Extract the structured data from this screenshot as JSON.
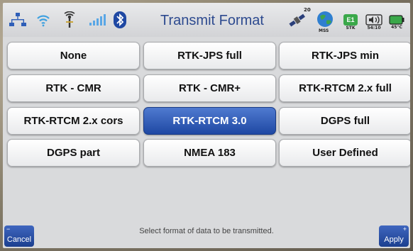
{
  "header": {
    "title": "Transmit Format",
    "satellite_count": "20",
    "mode_top": "E1",
    "mode_bottom": "STK",
    "time": "54:10",
    "temperature": "45°C",
    "antenna_label": "MSS",
    "accent_color": "#2d4a8f"
  },
  "formats": {
    "none": "None",
    "rtk_jps_full": "RTK-JPS full",
    "rtk_jps_min": "RTK-JPS min",
    "rtk_cmr": "RTK - CMR",
    "rtk_cmr_plus": "RTK - CMR+",
    "rtk_rtcm2_full": "RTK-RTCM 2.x full",
    "rtk_rtcm2_cors": "RTK-RTCM 2.x cors",
    "rtk_rtcm3": "RTK-RTCM 3.0",
    "dgps_full": "DGPS full",
    "dgps_part": "DGPS part",
    "nmea183": "NMEA 183",
    "user_defined": "User Defined",
    "selected": "RTK-RTCM 3.0",
    "selected_color": "#1f48a3"
  },
  "footer": {
    "hint": "Select format of data to be transmitted.",
    "cancel_label": "Cancel",
    "apply_label": "Apply"
  },
  "icons": [
    "network-icon",
    "wifi-icon",
    "antenna-icon",
    "signal-bars-icon",
    "bluetooth-icon",
    "satellite-icon",
    "globe-icon",
    "mode-icon",
    "radio-speaker-icon",
    "battery-icon",
    "cancel-minus-icon",
    "apply-plus-icon"
  ]
}
